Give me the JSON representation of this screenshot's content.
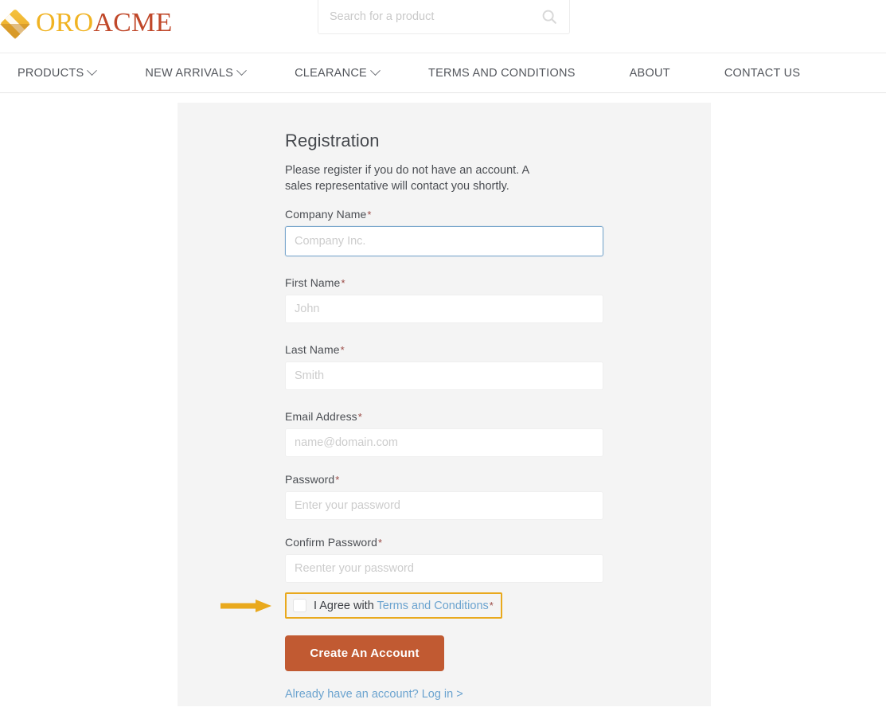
{
  "brand": {
    "logo_icon": "oro-diamond-logo-icon",
    "name_part1": "ORO",
    "name_part2": "ACME",
    "color_oro": "#f0b323",
    "color_acme": "#c0482a"
  },
  "search": {
    "placeholder": "Search for a product",
    "value": "",
    "icon": "search-icon"
  },
  "nav": {
    "items": [
      {
        "label": "PRODUCTS",
        "caret": true
      },
      {
        "label": "NEW ARRIVALS",
        "caret": true
      },
      {
        "label": "CLEARANCE",
        "caret": true
      },
      {
        "label": "TERMS AND CONDITIONS",
        "caret": false
      },
      {
        "label": "ABOUT",
        "caret": false
      },
      {
        "label": "CONTACT US",
        "caret": false
      }
    ]
  },
  "registration": {
    "title": "Registration",
    "intro": "Please register if you do not have an account. A sales representative will contact you shortly.",
    "required_marker": "*",
    "fields": [
      {
        "label": "Company Name",
        "placeholder": "Company Inc.",
        "value": "",
        "required": true,
        "focused": true,
        "type": "text"
      },
      {
        "label": "First Name",
        "placeholder": "John",
        "value": "",
        "required": true,
        "focused": false,
        "type": "text"
      },
      {
        "label": "Last Name",
        "placeholder": "Smith",
        "value": "",
        "required": true,
        "focused": false,
        "type": "text"
      },
      {
        "label": "Email Address",
        "placeholder": "name@domain.com",
        "value": "",
        "required": true,
        "focused": false,
        "type": "email"
      },
      {
        "label": "Password",
        "placeholder": "Enter your password",
        "value": "",
        "required": true,
        "focused": false,
        "type": "password"
      },
      {
        "label": "Confirm Password",
        "placeholder": "Reenter your password",
        "value": "",
        "required": true,
        "focused": false,
        "type": "password"
      }
    ],
    "agree": {
      "prefix": "I Agree with ",
      "link_text": "Terms and Conditions",
      "required_marker": "*",
      "checked": false,
      "highlight_color": "#e9a91d",
      "annotation_icon": "right-arrow-annotation-icon"
    },
    "submit_label": "Create An Account",
    "submit_color": "#c15a32",
    "login_link": "Already have an account? Log in >"
  }
}
